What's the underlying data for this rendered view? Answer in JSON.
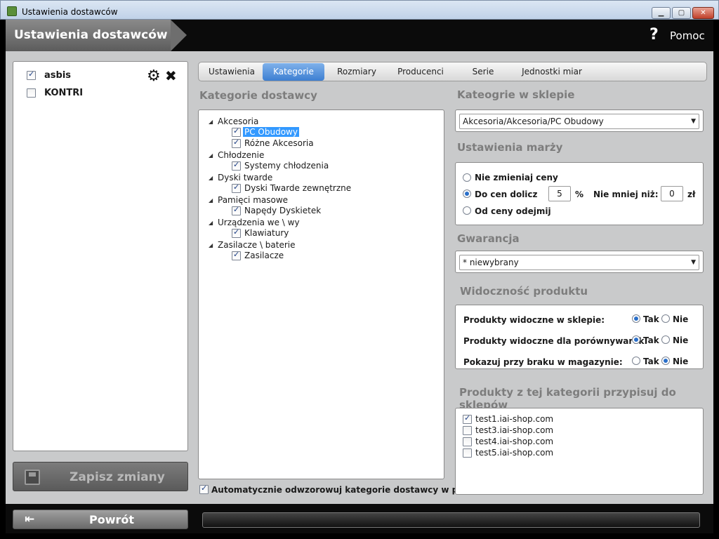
{
  "window": {
    "title": "Ustawienia dostawców",
    "min_glyph": "▁",
    "max_glyph": "▢",
    "close_glyph": "✕"
  },
  "header": {
    "title": "Ustawienia dostawców",
    "help_label": "Pomoc",
    "help_icon": "?"
  },
  "suppliers": [
    {
      "name": "asbis",
      "checked": true
    },
    {
      "name": "KONTRI",
      "checked": false
    }
  ],
  "supplier_actions": {
    "gear_icon": "⚙",
    "close_icon": "✖"
  },
  "save_button": {
    "label": "Zapisz zmiany"
  },
  "tabs": [
    {
      "label": "Ustawienia",
      "active": false
    },
    {
      "label": "Kategorie",
      "active": true
    },
    {
      "label": "Rozmiary",
      "active": false
    },
    {
      "label": "Producenci",
      "active": false
    },
    {
      "label": "Serie",
      "active": false
    },
    {
      "label": "Jednostki miar",
      "active": false
    }
  ],
  "supplier_categories": {
    "title": "Kategorie dostawcy",
    "groups": [
      {
        "name": "Akcesoria",
        "children": [
          {
            "name": "PC Obudowy",
            "checked": true,
            "selected": true
          },
          {
            "name": "Różne Akcesoria",
            "checked": true
          }
        ]
      },
      {
        "name": "Chłodzenie",
        "children": [
          {
            "name": "Systemy chłodzenia",
            "checked": true
          }
        ]
      },
      {
        "name": "Dyski twarde",
        "children": [
          {
            "name": "Dyski Twarde zewnętrzne",
            "checked": true
          }
        ]
      },
      {
        "name": "Pamięci masowe",
        "children": [
          {
            "name": "Napędy Dyskietek",
            "checked": true
          }
        ]
      },
      {
        "name": "Urządzenia we \\ wy",
        "children": [
          {
            "name": "Klawiatury",
            "checked": true
          }
        ]
      },
      {
        "name": "Zasilacze  \\  baterie",
        "children": [
          {
            "name": "Zasilacze",
            "checked": true
          }
        ]
      }
    ],
    "auto_map_label": "Automatycznie odwzorowuj kategorie dostawcy w panelu",
    "auto_map_checked": true
  },
  "shop_categories": {
    "title": "Kateogrie w sklepie",
    "value": "Akcesoria/Akcesoria/PC Obudowy"
  },
  "margin": {
    "title": "Ustawienia marży",
    "opt_no_change": "Nie zmieniaj ceny",
    "opt_add": "Do cen dolicz",
    "opt_subtract": "Od ceny odejmij",
    "selected": "add",
    "add_value": "5",
    "percent": "%",
    "min_label": "Nie mniej niż:",
    "min_value": "0",
    "currency": "zł"
  },
  "warranty": {
    "title": "Gwarancja",
    "value": "* niewybrany"
  },
  "visibility": {
    "title": "Widoczność produktu",
    "rows": [
      {
        "label": "Produkty widoczne w sklepie:",
        "value": "Tak"
      },
      {
        "label": "Produkty widoczne dla porównywarek:",
        "value": "Tak"
      },
      {
        "label": "Pokazuj przy braku w magazynie:",
        "value": "Nie"
      }
    ],
    "yes": "Tak",
    "no": "Nie"
  },
  "assign_shops": {
    "title": "Produkty z tej kategorii przypisuj do sklepów",
    "shops": [
      {
        "name": "test1.iai-shop.com",
        "checked": true
      },
      {
        "name": "test3.iai-shop.com",
        "checked": false
      },
      {
        "name": "test4.iai-shop.com",
        "checked": false
      },
      {
        "name": "test5.iai-shop.com",
        "checked": false
      }
    ]
  },
  "footer": {
    "back_label": "Powrót",
    "back_icon": "⇤",
    "progress": 0
  },
  "colors": {
    "active_tab": "#3d7fd2",
    "header_bg": "#0b0b0b",
    "panel_bg": "#c9cacb"
  }
}
